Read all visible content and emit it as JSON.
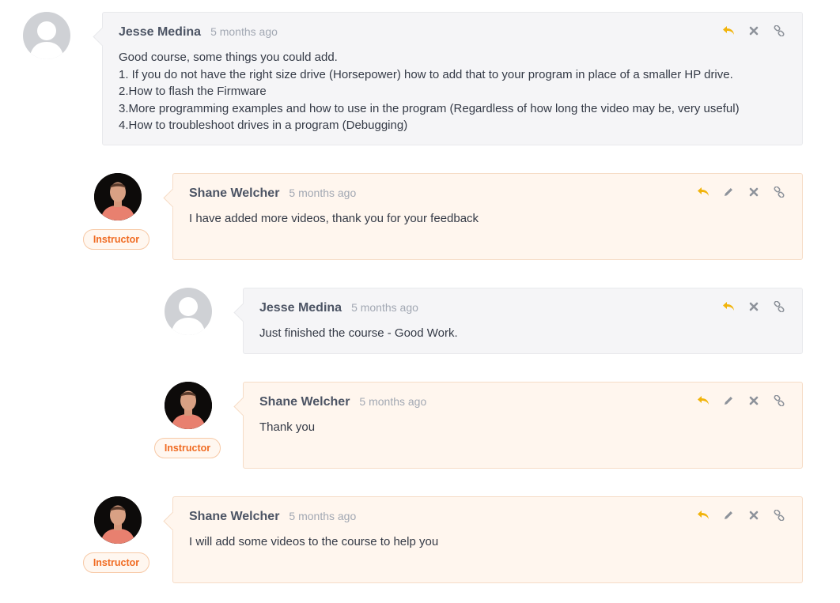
{
  "colors": {
    "reply": "#f1b40c",
    "action_gray": "#8e939b",
    "instructor_orange": "#f06b22",
    "box_gray": "#f5f5f7",
    "box_peach": "#fff6ee"
  },
  "comments": [
    {
      "author": "Jesse Medina",
      "time": "5 months ago",
      "lines": [
        "Good course, some things you could add.",
        "1. If you do not have the right size drive (Horsepower) how to add that to your program in place of a smaller HP drive.",
        "2.How to flash the Firmware",
        "3.More programming examples and how to use in the program (Regardless of how long the video may be, very useful)",
        "4.How to troubleshoot drives in a program (Debugging)"
      ]
    },
    {
      "author": "Shane Welcher",
      "time": "5 months ago",
      "badge": "Instructor",
      "lines": [
        "I have added more videos, thank you for your feedback"
      ]
    },
    {
      "author": "Jesse Medina",
      "time": "5 months ago",
      "lines": [
        "Just finished the course - Good Work."
      ]
    },
    {
      "author": "Shane Welcher",
      "time": "5 months ago",
      "badge": "Instructor",
      "lines": [
        "Thank you"
      ]
    },
    {
      "author": "Shane Welcher",
      "time": "5 months ago",
      "badge": "Instructor",
      "lines": [
        "I will add some videos to the course to help you"
      ]
    }
  ]
}
